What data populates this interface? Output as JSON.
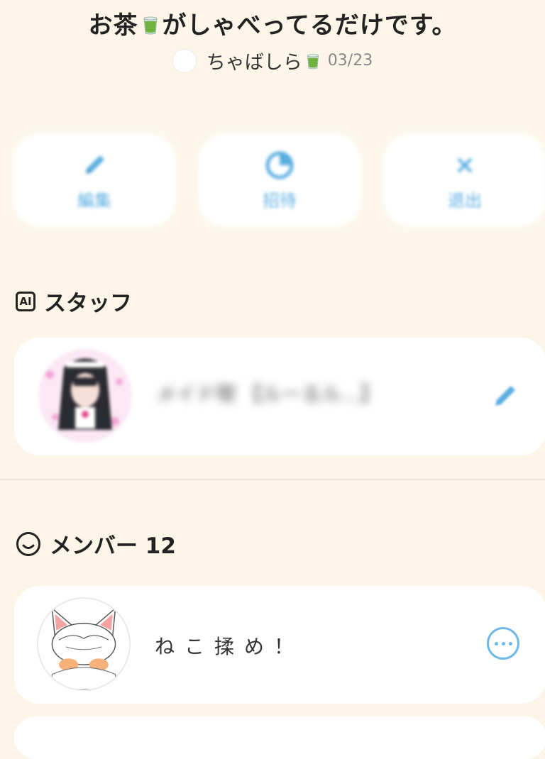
{
  "header": {
    "title_part1": "お茶",
    "title_part2": "がしゃべってるだけです。",
    "author": "ちゃばしら",
    "date": "03/23"
  },
  "actions": [
    {
      "label": "編集",
      "icon": "pencil-icon"
    },
    {
      "label": "招待",
      "icon": "clock-icon"
    },
    {
      "label": "退出",
      "icon": "close-icon"
    }
  ],
  "staff_section": {
    "icon_text": "AI",
    "heading": "スタッフ",
    "staff_name": "メイド喫 【ルーるル...】"
  },
  "member_section": {
    "heading": "メンバー 12",
    "members": [
      {
        "name": "ねこ揉め！"
      }
    ]
  },
  "colors": {
    "background": "#fdf6e8",
    "accent": "#5aaee0",
    "card": "#ffffff"
  }
}
